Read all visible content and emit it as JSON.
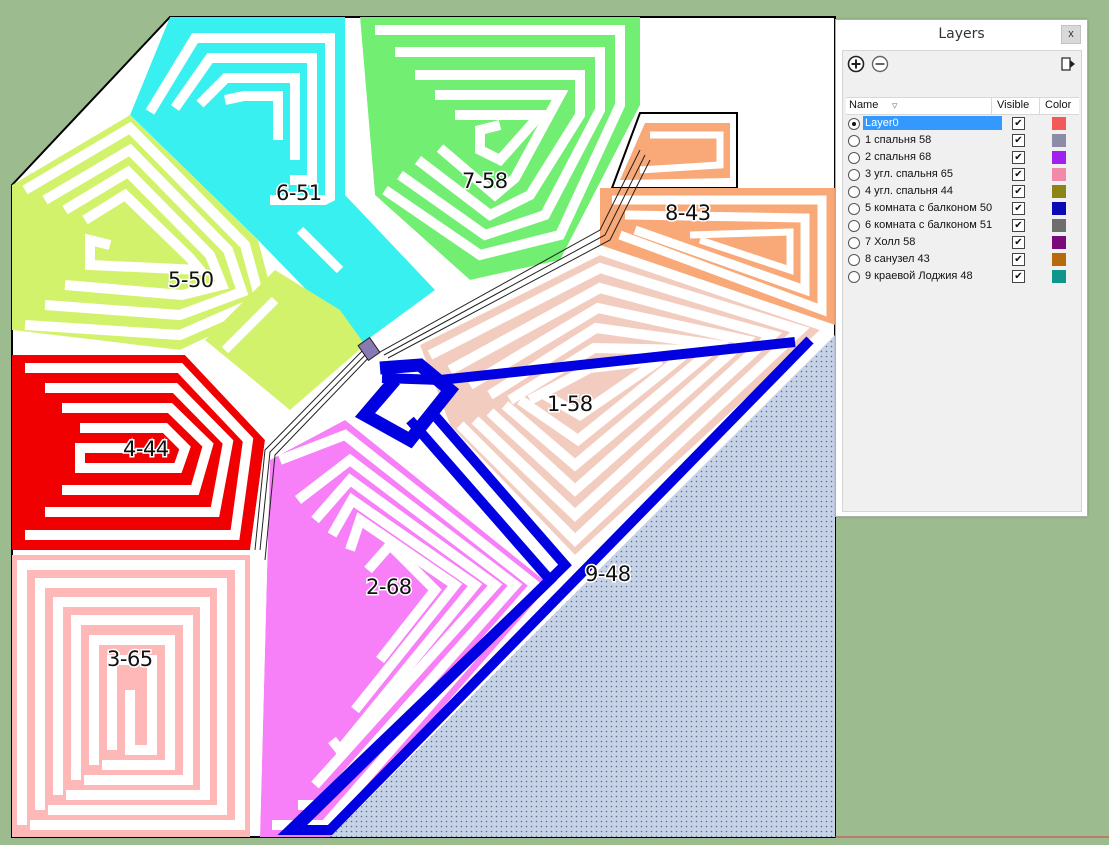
{
  "canvas": {
    "room_labels": [
      "6-51",
      "7-58",
      "8-43",
      "5-50",
      "4-44",
      "1-58",
      "2-68",
      "9-48",
      "3-65"
    ]
  },
  "layers_panel": {
    "title": "Layers",
    "close_label": "x",
    "columns": {
      "name": "Name",
      "visible": "Visible",
      "color": "Color"
    },
    "layers": [
      {
        "name": "Layer0",
        "active": true,
        "visible": true,
        "color": "#f25a5a"
      },
      {
        "name": "1 спальня 58",
        "active": false,
        "visible": true,
        "color": "#8c8ca6"
      },
      {
        "name": "2 спальня 68",
        "active": false,
        "visible": true,
        "color": "#a020f0"
      },
      {
        "name": "3 угл. спальня 65",
        "active": false,
        "visible": true,
        "color": "#f08aa8"
      },
      {
        "name": "4 угл. спальня 44",
        "active": false,
        "visible": true,
        "color": "#8b8518"
      },
      {
        "name": "5 комната с балконом 50",
        "active": false,
        "visible": true,
        "color": "#0a0ab4"
      },
      {
        "name": "6 комната с балконом 51",
        "active": false,
        "visible": true,
        "color": "#6e6e6e"
      },
      {
        "name": "7 Холл 58",
        "active": false,
        "visible": true,
        "color": "#7a0a7a"
      },
      {
        "name": "8  санузел 43",
        "active": false,
        "visible": true,
        "color": "#b7690c"
      },
      {
        "name": "9 краевой Лоджия 48",
        "active": false,
        "visible": true,
        "color": "#0f968c"
      }
    ]
  }
}
